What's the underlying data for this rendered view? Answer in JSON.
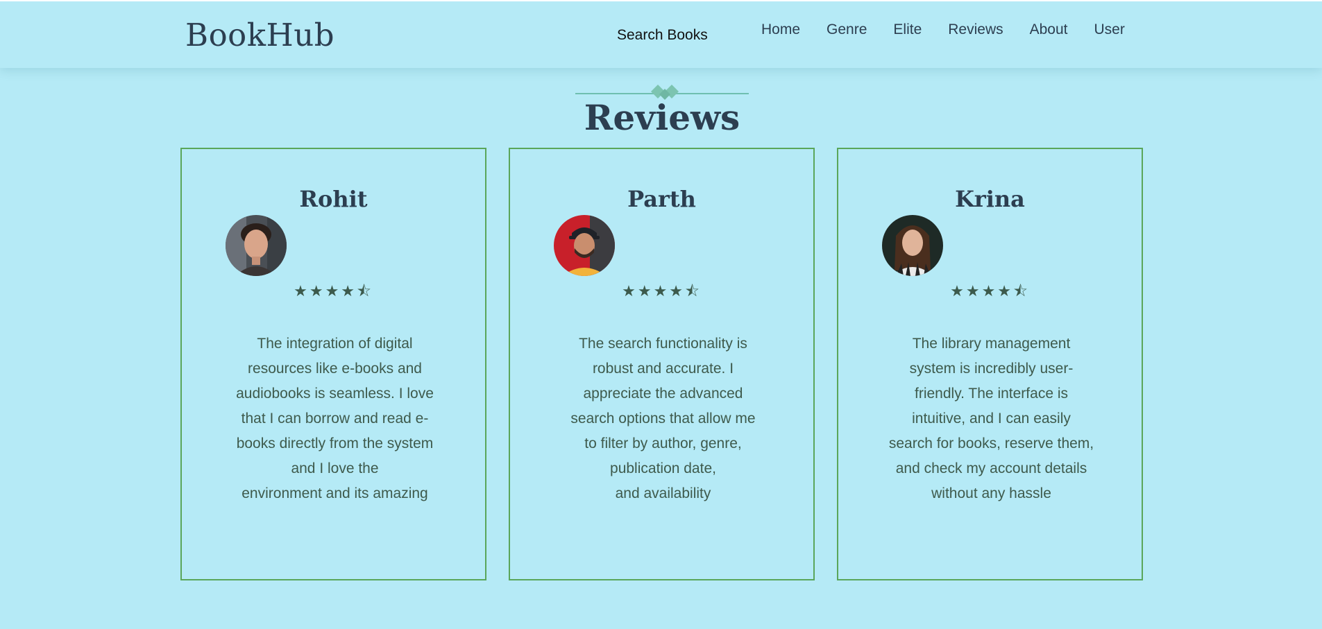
{
  "header": {
    "logo": "BookHub",
    "search_label": "Search Books",
    "nav": [
      "Home",
      "Genre",
      "Elite",
      "Reviews",
      "About",
      "User"
    ]
  },
  "section": {
    "title": "Reviews"
  },
  "reviews": [
    {
      "name": "Rohit",
      "rating": 4.5,
      "stars": "★★★★⯪",
      "text": "The integration of digital\nresources like e-books and\naudiobooks is seamless. I love\nthat I can borrow and read e-\nbooks directly from the system\nand I love the\nenvironment and its amazing"
    },
    {
      "name": "Parth",
      "rating": 4.5,
      "stars": "★★★★⯪",
      "text": "The search functionality is\nrobust and accurate. I\nappreciate the advanced\nsearch options that allow me\nto filter by author, genre,\npublication date,\nand availability"
    },
    {
      "name": "Krina",
      "rating": 4.5,
      "stars": "★★★★⯪",
      "text": "The library management\nsystem is incredibly user-\nfriendly. The interface is\nintuitive, and I can easily\nsearch for books, reserve them,\nand check my account details\nwithout any hassle"
    }
  ],
  "colors": {
    "background": "#b5eaf6",
    "heading": "#2c3e50",
    "card_border": "#5aa65a",
    "ornament": "#6fbfb0",
    "star": "#3c5a4c"
  },
  "icons": {
    "ornament": "diamond-ornament-icon",
    "star": "star-icon"
  }
}
